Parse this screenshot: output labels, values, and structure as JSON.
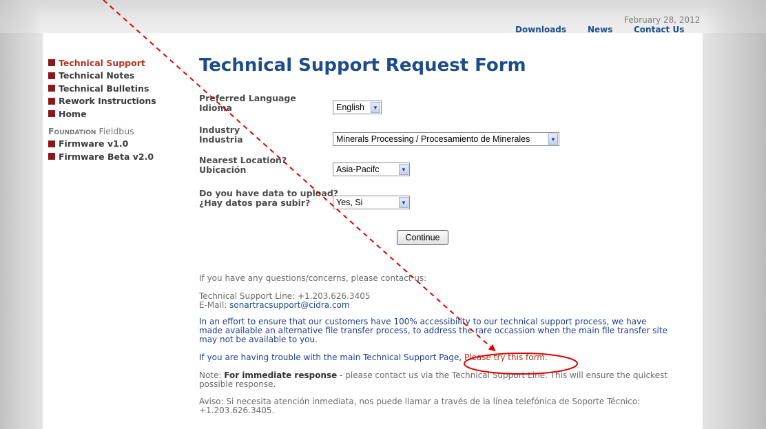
{
  "header": {
    "date": "February 28, 2012",
    "nav": [
      "Downloads",
      "News",
      "Contact Us"
    ]
  },
  "sidebar": {
    "items": [
      {
        "label": "Technical Support",
        "active": true
      },
      {
        "label": "Technical Notes"
      },
      {
        "label": "Technical Bulletins"
      },
      {
        "label": "Rework Instructions"
      },
      {
        "label": "Home"
      }
    ],
    "section": {
      "brand": "Foundation",
      "title": "Fieldbus"
    },
    "section_items": [
      {
        "label": "Firmware v1.0"
      },
      {
        "label": "Firmware Beta v2.0"
      }
    ]
  },
  "form": {
    "title": "Technical Support Request Form",
    "fields": [
      {
        "label": "Preferred Language",
        "label_es": "Idioma",
        "value": "English"
      },
      {
        "label": "Industry",
        "label_es": "Industria",
        "value": "Minerals Processing / Procesamiento de Minerales"
      },
      {
        "label": "Nearest Location?",
        "label_es": "Ubicación",
        "value": "Asia-Pacifc"
      },
      {
        "label": "Do you have data to upload?",
        "label_es": "¿Hay datos para subir?",
        "value": "Yes, Si"
      }
    ],
    "continue_label": "Continue"
  },
  "info": {
    "contact_intro": "If you have any questions/concerns, please contact us:",
    "support_line": "Technical Support Line: +1.203.626.3405",
    "email_label": "E-Mail: ",
    "email": "sonartracsupport@cidra.com",
    "accessibility_text": "In an effort to ensure that our customers have 100% accessibility to our technical support process, we have made available an alternative file transfer process, to address the rare occassion when the main file transfer site may not be available to you.",
    "trouble_text": "If you are having trouble with the main Technical Support Page, ",
    "trouble_link": "Please try this form.",
    "note_prefix": "Note: ",
    "note_bold": "For immediate response",
    "note_rest": " - please contact us via the Technical Support Line. This will ensure the quickest possible response.",
    "aviso": "Aviso: Si necesita atención inmediata, nos puede llamar a través de la línea telefónica de Soporte Técnico: +1.203.626.3405."
  },
  "colors": {
    "title": "#1d4c8b",
    "active_nav": "#b0341d",
    "annotation": "#e00000"
  }
}
